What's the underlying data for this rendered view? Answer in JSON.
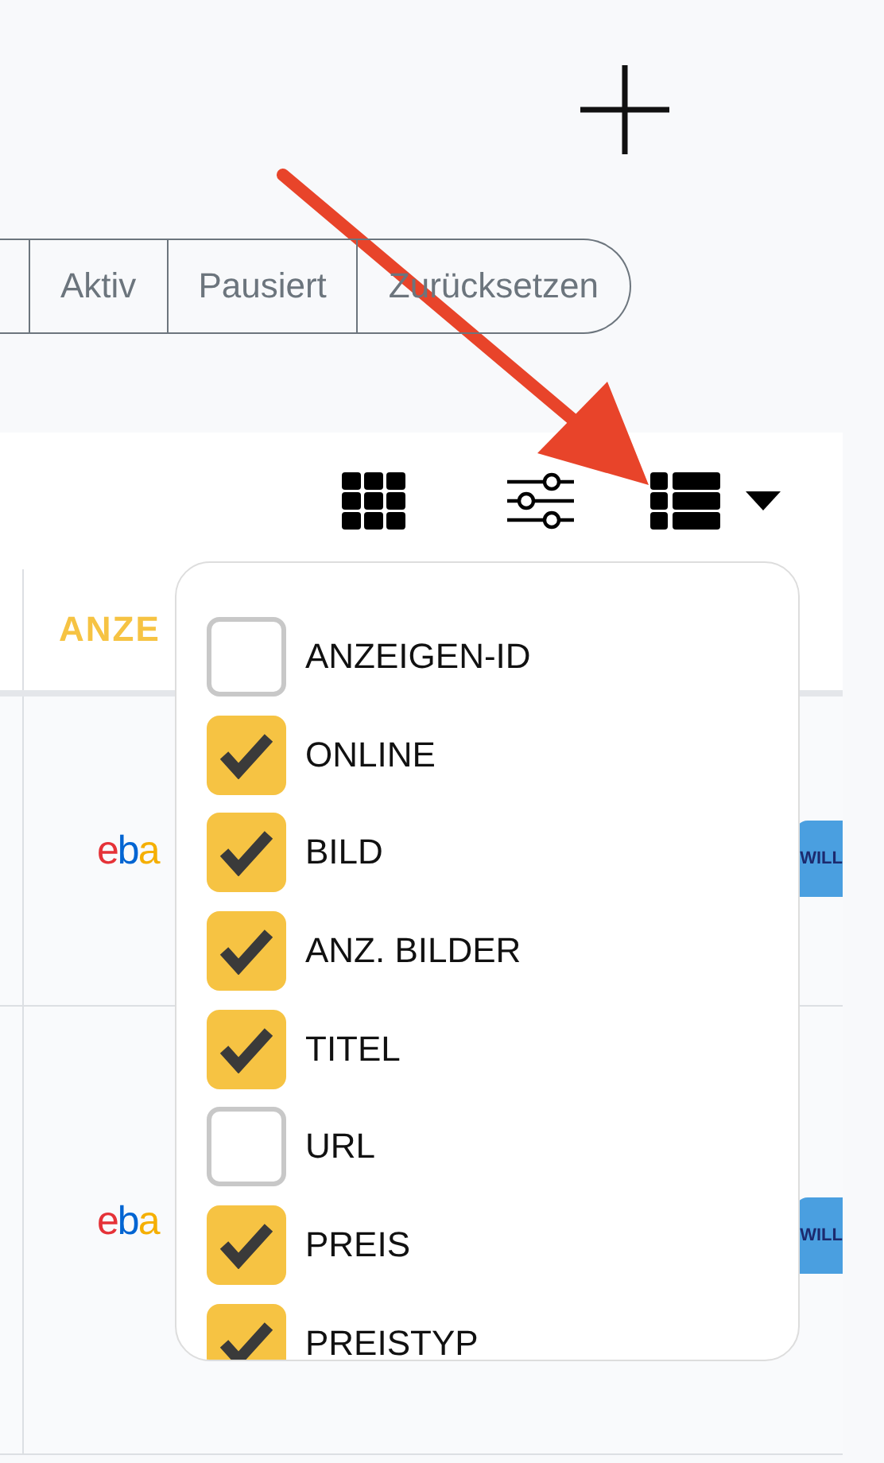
{
  "filters": [
    {
      "label": "Aktiv"
    },
    {
      "label": "Pausiert"
    },
    {
      "label": "Zurücksetzen"
    }
  ],
  "table": {
    "columns": [
      {
        "label": "ANZE"
      }
    ],
    "rows": [
      {
        "marketplace": "eba",
        "badge": "WILL"
      },
      {
        "marketplace": "eba",
        "badge": "WILL"
      }
    ]
  },
  "column_menu": {
    "items": [
      {
        "label": "ANZEIGEN-ID",
        "checked": false
      },
      {
        "label": "ONLINE",
        "checked": true
      },
      {
        "label": "BILD",
        "checked": true
      },
      {
        "label": "ANZ. BILDER",
        "checked": true
      },
      {
        "label": "TITEL",
        "checked": true
      },
      {
        "label": "URL",
        "checked": false
      },
      {
        "label": "PREIS",
        "checked": true
      },
      {
        "label": "PREISTYP",
        "checked": true
      }
    ]
  }
}
